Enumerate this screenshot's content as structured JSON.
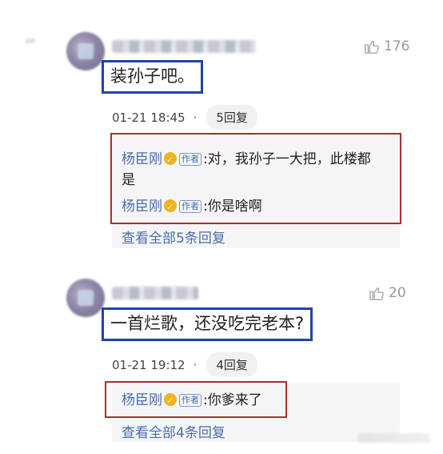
{
  "comments": [
    {
      "likes": "176",
      "text": "装孙子吧。",
      "time": "01-21 18:45",
      "separator": "·",
      "reply_count": "5回复",
      "replies": [
        {
          "name": "杨臣刚",
          "tag": "作者",
          "colon": ":",
          "text_line1": "对，我孙子一大把，此楼都",
          "text_line2": "是"
        },
        {
          "name": "杨臣刚",
          "tag": "作者",
          "colon": ":",
          "text_line1": "你是啥啊"
        }
      ],
      "view_all": "查看全部5条回复"
    },
    {
      "likes": "20",
      "text": "一首烂歌，还没吃完老本?",
      "time": "01-21 19:12",
      "separator": "·",
      "reply_count": "4回复",
      "replies": [
        {
          "name": "杨臣刚",
          "tag": "作者",
          "colon": ":",
          "text_line1": "你爹来了"
        }
      ],
      "view_all": "查看全部4条回复"
    }
  ],
  "colors": {
    "highlight_blue": "#1f44a8",
    "highlight_red": "#a8302e",
    "link_blue": "#4a6ea9",
    "verified_gold": "#f3b31b"
  },
  "icons": {
    "like": "thumbs-up-icon",
    "verified": "verified-badge-icon"
  }
}
